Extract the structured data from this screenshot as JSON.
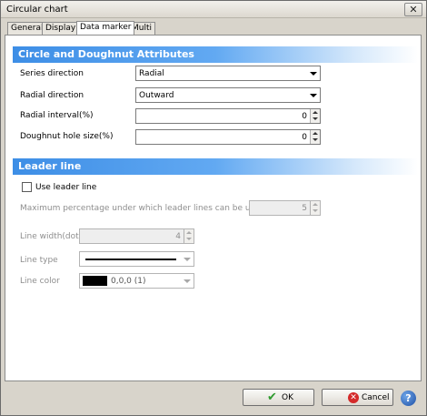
{
  "window": {
    "title": "Circular chart",
    "close_glyph": "✕"
  },
  "tabs": [
    {
      "label": "General"
    },
    {
      "label": "Display"
    },
    {
      "label": "Data marker",
      "active": true
    },
    {
      "label": "Multi"
    }
  ],
  "circle_section": {
    "title": "Circle and Doughnut Attributes",
    "series_direction": {
      "label": "Series direction",
      "value": "Radial"
    },
    "radial_direction": {
      "label": "Radial direction",
      "value": "Outward"
    },
    "radial_interval": {
      "label": "Radial interval(%)",
      "value": "0"
    },
    "doughnut_hole": {
      "label": "Doughnut hole size(%)",
      "value": "0"
    }
  },
  "leader_section": {
    "title": "Leader line",
    "use_leader_line": {
      "label": "Use leader line",
      "checked": false
    },
    "max_percentage": {
      "label": "Maximum percentage under which leader lines can be used(%)",
      "value": "5"
    },
    "line_width": {
      "label": "Line width(dot)",
      "value": "4"
    },
    "line_type": {
      "label": "Line type"
    },
    "line_color": {
      "label": "Line color",
      "value": "0,0,0 (1)",
      "swatch": "#000000"
    }
  },
  "buttons": {
    "ok": "OK",
    "cancel": "Cancel",
    "help": "?"
  },
  "colors": {
    "section_header": "#3d8ee6",
    "ok_icon": "#2f9b2f",
    "cancel_icon": "#d42a2a",
    "help_icon": "#1d4fa5"
  },
  "icons": {
    "ok": "check-icon",
    "cancel": "cancel-icon",
    "help": "help-icon",
    "close": "close-icon"
  }
}
